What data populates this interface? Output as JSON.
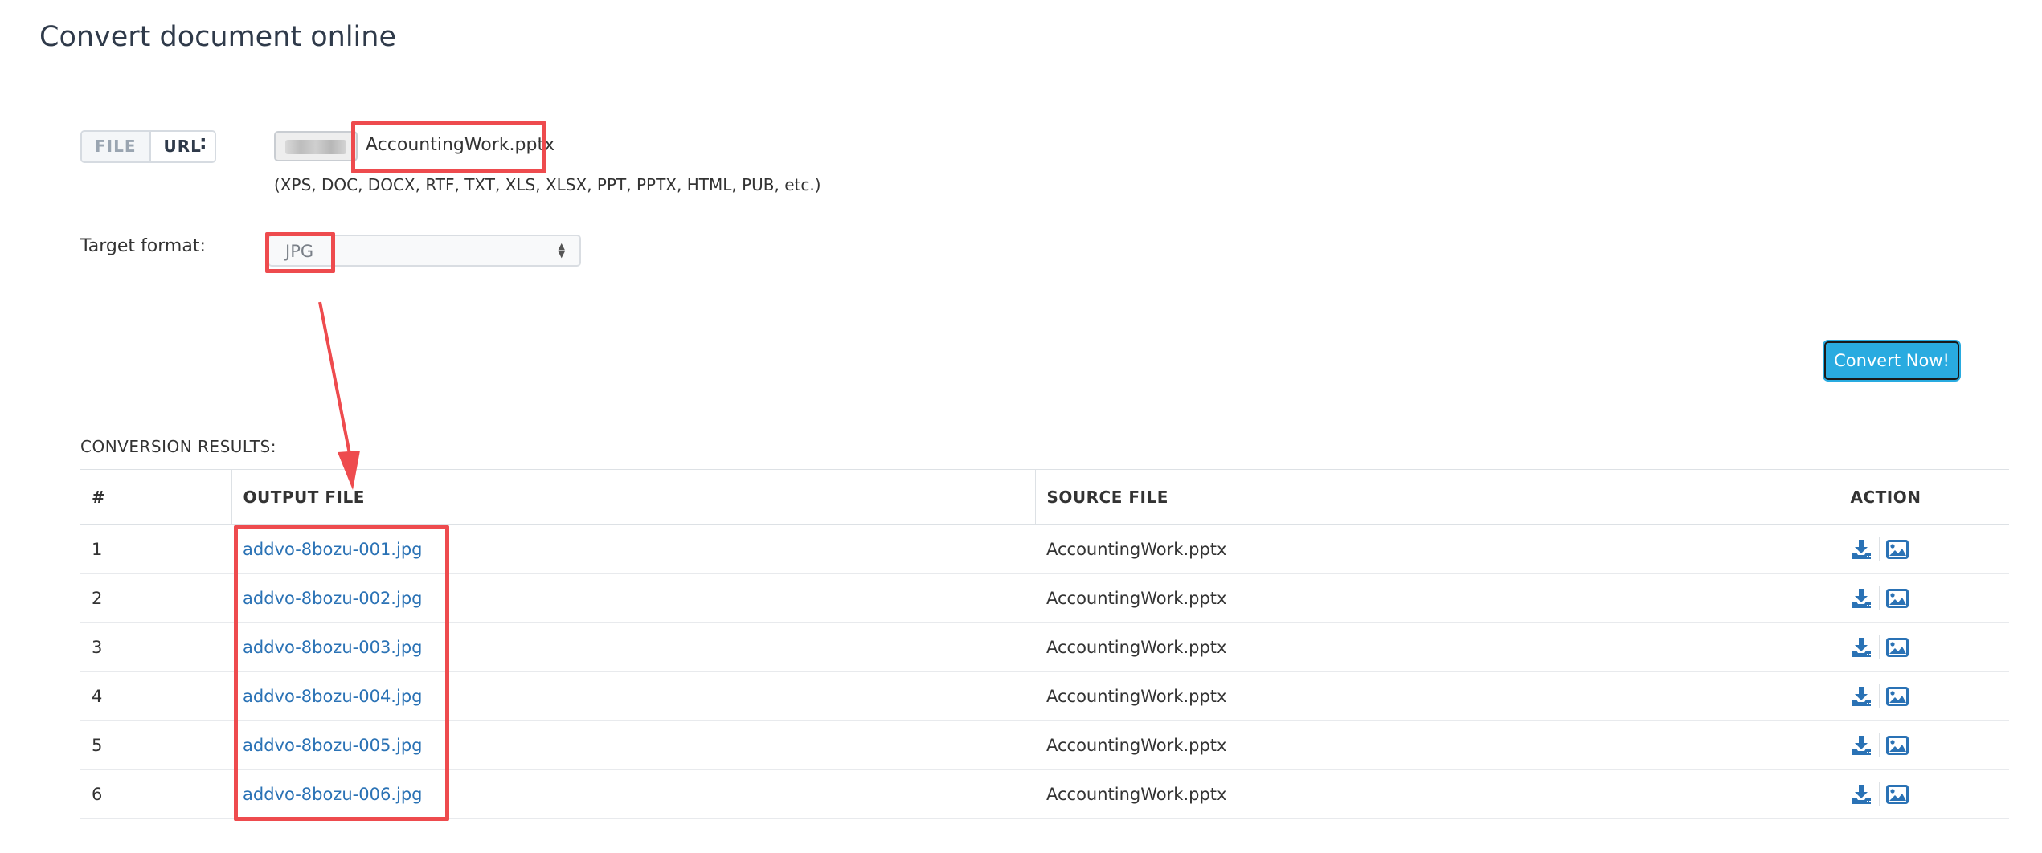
{
  "page": {
    "title": "Convert document online"
  },
  "input_mode": {
    "file_label": "FILE",
    "url_label": "URL",
    "colon": ":"
  },
  "file_input": {
    "file_name": "AccountingWork.pptx",
    "supported_formats": "(XPS, DOC, DOCX, RTF, TXT, XLS, XLSX, PPT, PPTX, HTML, PUB, etc.)"
  },
  "target_format": {
    "label": "Target format:",
    "selected": "JPG"
  },
  "convert": {
    "label": "Convert Now!"
  },
  "results": {
    "title": "CONVERSION RESULTS:",
    "columns": [
      "#",
      "OUTPUT FILE",
      "SOURCE FILE",
      "ACTION"
    ],
    "rows": [
      {
        "num": "1",
        "output": "addvo-8bozu-001.jpg",
        "source": "AccountingWork.pptx"
      },
      {
        "num": "2",
        "output": "addvo-8bozu-002.jpg",
        "source": "AccountingWork.pptx"
      },
      {
        "num": "3",
        "output": "addvo-8bozu-003.jpg",
        "source": "AccountingWork.pptx"
      },
      {
        "num": "4",
        "output": "addvo-8bozu-004.jpg",
        "source": "AccountingWork.pptx"
      },
      {
        "num": "5",
        "output": "addvo-8bozu-005.jpg",
        "source": "AccountingWork.pptx"
      },
      {
        "num": "6",
        "output": "addvo-8bozu-006.jpg",
        "source": "AccountingWork.pptx"
      }
    ],
    "action_icons": [
      "download-icon",
      "image-preview-icon"
    ]
  },
  "colors": {
    "link": "#2a72b5",
    "accent_button": "#29abe0",
    "annotation_red": "#ee4b4e",
    "icon_blue": "#2a72b5"
  }
}
